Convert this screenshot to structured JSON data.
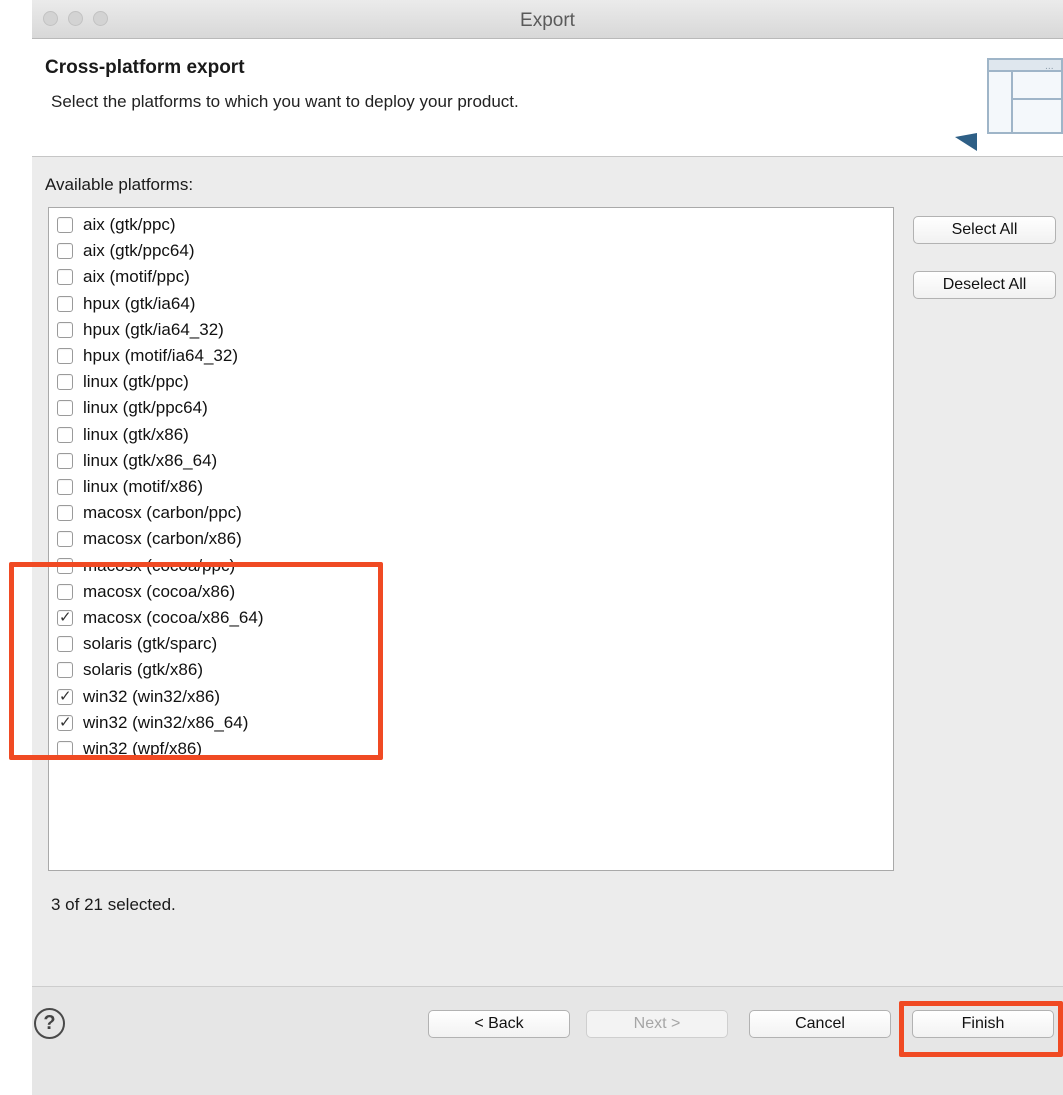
{
  "window": {
    "title": "Export"
  },
  "header": {
    "title": "Cross-platform export",
    "description": "Select the platforms to which you want to deploy your product."
  },
  "platforms": {
    "label": "Available platforms:",
    "items": [
      {
        "label": "aix (gtk/ppc)",
        "checked": false
      },
      {
        "label": "aix (gtk/ppc64)",
        "checked": false
      },
      {
        "label": "aix (motif/ppc)",
        "checked": false
      },
      {
        "label": "hpux (gtk/ia64)",
        "checked": false
      },
      {
        "label": "hpux (gtk/ia64_32)",
        "checked": false
      },
      {
        "label": "hpux (motif/ia64_32)",
        "checked": false
      },
      {
        "label": "linux (gtk/ppc)",
        "checked": false
      },
      {
        "label": "linux (gtk/ppc64)",
        "checked": false
      },
      {
        "label": "linux (gtk/x86)",
        "checked": false
      },
      {
        "label": "linux (gtk/x86_64)",
        "checked": false
      },
      {
        "label": "linux (motif/x86)",
        "checked": false
      },
      {
        "label": "macosx (carbon/ppc)",
        "checked": false
      },
      {
        "label": "macosx (carbon/x86)",
        "checked": false
      },
      {
        "label": "macosx (cocoa/ppc)",
        "checked": false
      },
      {
        "label": "macosx (cocoa/x86)",
        "checked": false
      },
      {
        "label": "macosx (cocoa/x86_64)",
        "checked": true
      },
      {
        "label": "solaris (gtk/sparc)",
        "checked": false
      },
      {
        "label": "solaris (gtk/x86)",
        "checked": false
      },
      {
        "label": "win32 (win32/x86)",
        "checked": true
      },
      {
        "label": "win32 (win32/x86_64)",
        "checked": true
      },
      {
        "label": "win32 (wpf/x86)",
        "checked": false
      }
    ],
    "select_all": "Select All",
    "deselect_all": "Deselect All",
    "status": "3 of 21 selected."
  },
  "footer": {
    "help": "?",
    "back": "< Back",
    "next": "Next >",
    "cancel": "Cancel",
    "finish": "Finish"
  },
  "colors": {
    "highlight": "#f04a23",
    "banner_accent": "#2e5f86"
  },
  "icons": {
    "help": "question-circle-icon",
    "banner": "wizard-banner-icon"
  }
}
